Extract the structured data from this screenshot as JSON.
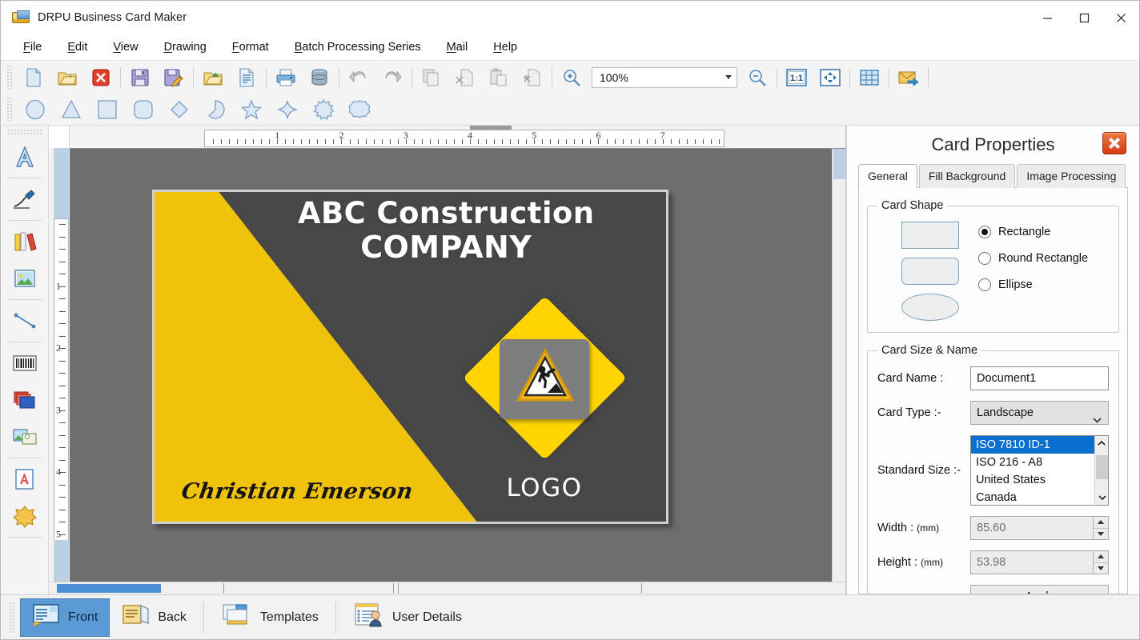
{
  "window": {
    "title": "DRPU Business Card Maker",
    "icon": "business-card-icon",
    "minimize": "minimize",
    "maximize": "maximize",
    "close": "close"
  },
  "menubar": {
    "items": [
      {
        "label": "File",
        "accel": "F"
      },
      {
        "label": "Edit",
        "accel": "E"
      },
      {
        "label": "View",
        "accel": "V"
      },
      {
        "label": "Drawing",
        "accel": "D"
      },
      {
        "label": "Format",
        "accel": "F"
      },
      {
        "label": "Batch Processing Series",
        "accel": "B"
      },
      {
        "label": "Mail",
        "accel": "M"
      },
      {
        "label": "Help",
        "accel": "H"
      }
    ]
  },
  "toolbar": {
    "buttons": [
      "new-document-icon",
      "open-folder-icon",
      "close-document-icon",
      "save-icon",
      "save-as-icon",
      "export-folder-icon",
      "document-properties-icon",
      "print-icon",
      "database-icon",
      "undo-icon",
      "redo-icon",
      "copy-icon",
      "cut-icon",
      "paste-icon",
      "delete-icon",
      "zoom-in-icon",
      "zoom-out-icon",
      "actual-size-icon",
      "fit-to-window-icon",
      "grid-icon",
      "send-mail-icon"
    ],
    "zoom_value": "100%",
    "zoom_dropdown": "chevron-down-icon",
    "actual_size_label": "1:1"
  },
  "shapes_toolbar": {
    "shapes": [
      "ellipse-shape-icon",
      "triangle-shape-icon",
      "square-shape-icon",
      "rounded-rect-shape-icon",
      "diamond-shape-icon",
      "pie-shape-icon",
      "star5-shape-icon",
      "star4-shape-icon",
      "burst-shape-icon",
      "polygon-shape-icon"
    ]
  },
  "left_rail": {
    "tools": [
      "text-tool-icon",
      "signature-tool-icon",
      "library-tool-icon",
      "image-tool-icon",
      "line-tool-icon",
      "barcode-tool-icon",
      "shapes-layer-tool-icon",
      "picture-frame-tool-icon",
      "text-document-tool-icon",
      "watermark-tool-icon"
    ]
  },
  "rulers": {
    "horizontal_ticks": [
      "1",
      "2",
      "3",
      "4",
      "5",
      "6",
      "7"
    ],
    "vertical_ticks": [
      "1",
      "2",
      "3",
      "4",
      "5"
    ]
  },
  "card": {
    "company_line1": "ABC Construction",
    "company_line2": "COMPANY",
    "person_name": "Christian Emerson",
    "logo_label": "LOGO",
    "logo_icon": "road-work-sign-icon",
    "colors": {
      "background": "#474747",
      "accent_yellow": "#efc20b",
      "logo_yellow": "#ffd400",
      "logo_square": "#7d7d7d",
      "text": "#ffffff",
      "canvas": "#6e6e6e",
      "border": "#cfcfcf"
    }
  },
  "properties_panel": {
    "title": "Card Properties",
    "close_icon": "close-panel-icon",
    "tabs": [
      {
        "label": "General",
        "active": true
      },
      {
        "label": "Fill Background",
        "active": false
      },
      {
        "label": "Image Processing",
        "active": false
      }
    ],
    "card_shape": {
      "legend": "Card Shape",
      "options": [
        {
          "label": "Rectangle",
          "selected": true
        },
        {
          "label": "Round Rectangle",
          "selected": false
        },
        {
          "label": "Ellipse",
          "selected": false
        }
      ],
      "previews": [
        "rectangle-preview",
        "round-rectangle-preview",
        "ellipse-preview"
      ]
    },
    "card_size": {
      "legend": "Card Size & Name",
      "card_name_label": "Card Name :",
      "card_name_value": "Document1",
      "card_type_label": "Card Type :-",
      "card_type_value": "Landscape",
      "card_type_chevron": "chevron-down-icon",
      "standard_size_label": "Standard Size :-",
      "standard_size_options": [
        {
          "label": "ISO 7810 ID-1",
          "selected": true
        },
        {
          "label": "ISO 216 - A8",
          "selected": false
        },
        {
          "label": "United States",
          "selected": false
        },
        {
          "label": "Canada",
          "selected": false
        }
      ],
      "scroll_up_icon": "chevron-up-icon",
      "scroll_down_icon": "chevron-down-icon",
      "width_label": "Width :",
      "width_unit": "(mm)",
      "width_value": "85.60",
      "height_label": "Height :",
      "height_unit": "(mm)",
      "height_value": "53.98",
      "apply_label": "Apply"
    }
  },
  "bottom_tabs": [
    {
      "label": "Front",
      "icon": "front-card-icon",
      "active": true
    },
    {
      "label": "Back",
      "icon": "back-card-icon",
      "active": false
    },
    {
      "label": "Templates",
      "icon": "templates-icon",
      "active": false
    },
    {
      "label": "User Details",
      "icon": "user-details-icon",
      "active": false
    }
  ]
}
